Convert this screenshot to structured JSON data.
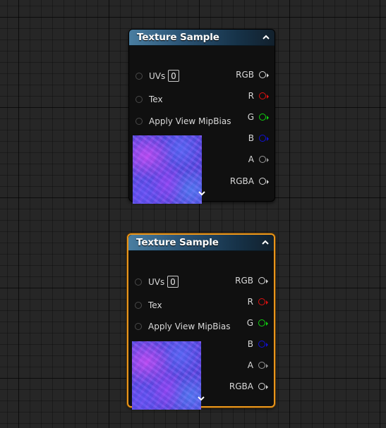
{
  "nodes": [
    {
      "title": "Texture Sample",
      "selected": false,
      "inputs": [
        {
          "label": "UVs",
          "value": "0"
        },
        {
          "label": "Tex"
        },
        {
          "label": "Apply View MipBias"
        }
      ],
      "outputs": [
        {
          "label": "RGB",
          "color": "#d8d8d8"
        },
        {
          "label": "R",
          "color": "#e01010"
        },
        {
          "label": "G",
          "color": "#10d010"
        },
        {
          "label": "B",
          "color": "#1010d8"
        },
        {
          "label": "A",
          "color": "#9a9a9a"
        },
        {
          "label": "RGBA",
          "color": "#d8d8d8"
        }
      ]
    },
    {
      "title": "Texture Sample",
      "selected": true,
      "inputs": [
        {
          "label": "UVs",
          "value": "0"
        },
        {
          "label": "Tex"
        },
        {
          "label": "Apply View MipBias"
        }
      ],
      "outputs": [
        {
          "label": "RGB",
          "color": "#d8d8d8"
        },
        {
          "label": "R",
          "color": "#e01010"
        },
        {
          "label": "G",
          "color": "#10d010"
        },
        {
          "label": "B",
          "color": "#1010d8"
        },
        {
          "label": "A",
          "color": "#9a9a9a"
        },
        {
          "label": "RGBA",
          "color": "#d8d8d8"
        }
      ]
    }
  ],
  "icons": {
    "collapse": "chevron-up-icon",
    "expand": "chevron-down-icon"
  }
}
